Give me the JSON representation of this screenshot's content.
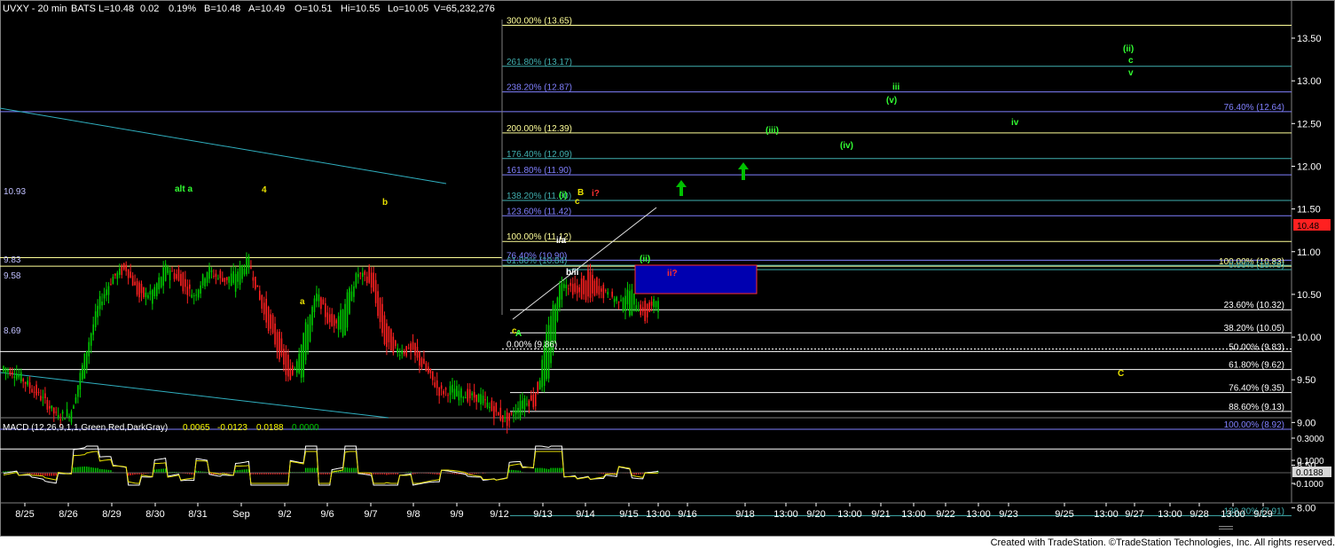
{
  "header": {
    "symbol": "UVXY - 20 min",
    "feed": "BATS",
    "last": "L=10.48",
    "chg": "0.02",
    "pct": "0.19%",
    "bid": "B=10.48",
    "ask": "A=10.49",
    "open": "O=10.51",
    "hi": "Hi=10.55",
    "lo": "Lo=10.05",
    "vol": "V=65,232,276"
  },
  "macd": {
    "label": "MACD (12,26,9,1,1,Green,Red,DarkGray)",
    "v1": "0.0065",
    "v2": "-0.0123",
    "v3": "0.0188",
    "v4": "0.0000",
    "axis_ticks": [
      "0.3000",
      "0.1000",
      "-0.1000"
    ],
    "current_label": "0.0188"
  },
  "footer": {
    "credit": "Created with TradeStation. ©TradeStation Technologies, Inc. All rights reserved."
  },
  "colors": {
    "bg": "#000000",
    "up": "#00cc00",
    "down": "#ff0000",
    "fib_yellow": "#ffff99",
    "fib_blue": "#8080ff",
    "fib_teal": "#40b0b0",
    "wave_green": "#33ff33",
    "wave_yellow": "#e8e000",
    "arrow": "#00c000"
  },
  "chart_data": {
    "type": "candlestick",
    "symbol": "UVXY",
    "interval": "20 min",
    "ylim": [
      7.55,
      13.85
    ],
    "y_ticks": [
      "13.50",
      "13.00",
      "12.50",
      "12.00",
      "11.50",
      "11.00",
      "10.50",
      "10.00",
      "9.50",
      "9.00",
      "8.50",
      "8.00"
    ],
    "x_ticks": [
      "8/25",
      "8/26",
      "8/29",
      "8/30",
      "8/31",
      "Sep",
      "9/2",
      "9/6",
      "9/7",
      "9/8",
      "9/9",
      "9/12",
      "9/13",
      "9/14",
      "9/15",
      "13:00",
      "9/16",
      "9/18",
      "13:00",
      "9/20",
      "13:00",
      "9/21",
      "13:00",
      "9/22",
      "13:00",
      "9/23",
      "9/25",
      "13:00",
      "9/27",
      "13:00",
      "9/28",
      "13:00",
      "9/29"
    ],
    "last_price": "10.48",
    "price_path": [
      [
        9.6,
        9.65
      ],
      [
        9.55,
        9.58
      ],
      [
        9.45,
        9.4
      ],
      [
        9.3,
        9.25
      ],
      [
        9.1,
        9.05
      ],
      [
        9.05,
        9.15
      ],
      [
        9.6,
        9.8
      ],
      [
        10.3,
        10.4
      ],
      [
        10.65,
        10.7
      ],
      [
        10.85,
        10.8
      ],
      [
        10.6,
        10.45
      ],
      [
        10.4,
        10.55
      ],
      [
        10.7,
        10.85
      ],
      [
        10.8,
        10.6
      ],
      [
        10.45,
        10.5
      ],
      [
        10.7,
        10.8
      ],
      [
        10.75,
        10.65
      ],
      [
        10.55,
        10.75
      ],
      [
        10.85,
        10.9
      ],
      [
        10.5,
        10.3
      ],
      [
        10.1,
        9.9
      ],
      [
        9.7,
        9.45
      ],
      [
        9.55,
        10.05
      ],
      [
        10.45,
        10.5
      ],
      [
        10.3,
        10.1
      ],
      [
        10.0,
        10.4
      ],
      [
        10.7,
        10.75
      ],
      [
        10.8,
        10.6
      ],
      [
        10.2,
        9.9
      ],
      [
        9.8,
        9.85
      ],
      [
        9.95,
        9.8
      ],
      [
        9.7,
        9.6
      ],
      [
        9.4,
        9.35
      ],
      [
        9.3,
        9.4
      ],
      [
        9.35,
        9.3
      ],
      [
        9.25,
        9.3
      ],
      [
        9.2,
        9.1
      ],
      [
        9.05,
        9.0
      ],
      [
        9.1,
        9.3
      ],
      [
        9.4,
        9.2
      ],
      [
        9.5,
        10.2
      ],
      [
        10.55,
        10.7
      ],
      [
        10.6,
        10.5
      ],
      [
        10.75,
        10.45
      ],
      [
        10.6,
        10.5
      ],
      [
        10.4,
        10.45
      ],
      [
        10.3,
        10.55
      ],
      [
        10.4,
        10.2
      ],
      [
        10.35,
        10.48
      ]
    ],
    "levels": [
      {
        "label": "300.00% (13.65)",
        "value": 13.65
      },
      {
        "label": "261.80% (13.17)",
        "value": 13.17
      },
      {
        "label": "238.20% (12.87)",
        "value": 12.87
      },
      {
        "label": "200.00% (12.39)",
        "value": 12.39
      },
      {
        "label": "176.40% (12.09)",
        "value": 12.09
      },
      {
        "label": "161.80% (11.90)",
        "value": 11.9
      },
      {
        "label": "138.20% (11.60)",
        "value": 11.6
      },
      {
        "label": "123.60% (11.42)",
        "value": 11.42
      },
      {
        "label": "100.00% (11.12)",
        "value": 11.12
      },
      {
        "label": "76.40% (10.90)",
        "value": 10.9
      },
      {
        "label": "61.80% (10.84)",
        "value": 10.84
      },
      {
        "label": "0.00% (9.86)",
        "value": 9.86
      },
      {
        "label": "76.40% (12.64)",
        "value": 12.64
      },
      {
        "label": "100.00% (10.83)",
        "value": 10.83
      },
      {
        "label": "0.00% (10.79)",
        "value": 10.79
      },
      {
        "label": "23.60% (10.32)",
        "value": 10.32
      },
      {
        "label": "38.20% (10.05)",
        "value": 10.05
      },
      {
        "label": "50.00% (9.83)",
        "value": 9.83
      },
      {
        "label": "61.80% (9.62)",
        "value": 9.62
      },
      {
        "label": "76.40% (9.35)",
        "value": 9.35
      },
      {
        "label": "88.60% (9.13)",
        "value": 9.13
      },
      {
        "label": "100.00% (8.92)",
        "value": 8.92
      },
      {
        "label": "138.20% (7.91)",
        "value": 7.91
      }
    ],
    "horizontal_labels": [
      "10.93",
      "9.83",
      "9.58",
      "8.69"
    ],
    "wave_labels": [
      "alt a",
      "4",
      "b",
      "a",
      "c",
      "A",
      "i/a",
      "b/ii",
      "(i)",
      "B",
      "c",
      "i?",
      "(ii)",
      "ii?",
      "(iii)",
      "(iv)",
      "iii",
      "(v)",
      "iv",
      "(ii)",
      "c",
      "v",
      "C"
    ]
  }
}
